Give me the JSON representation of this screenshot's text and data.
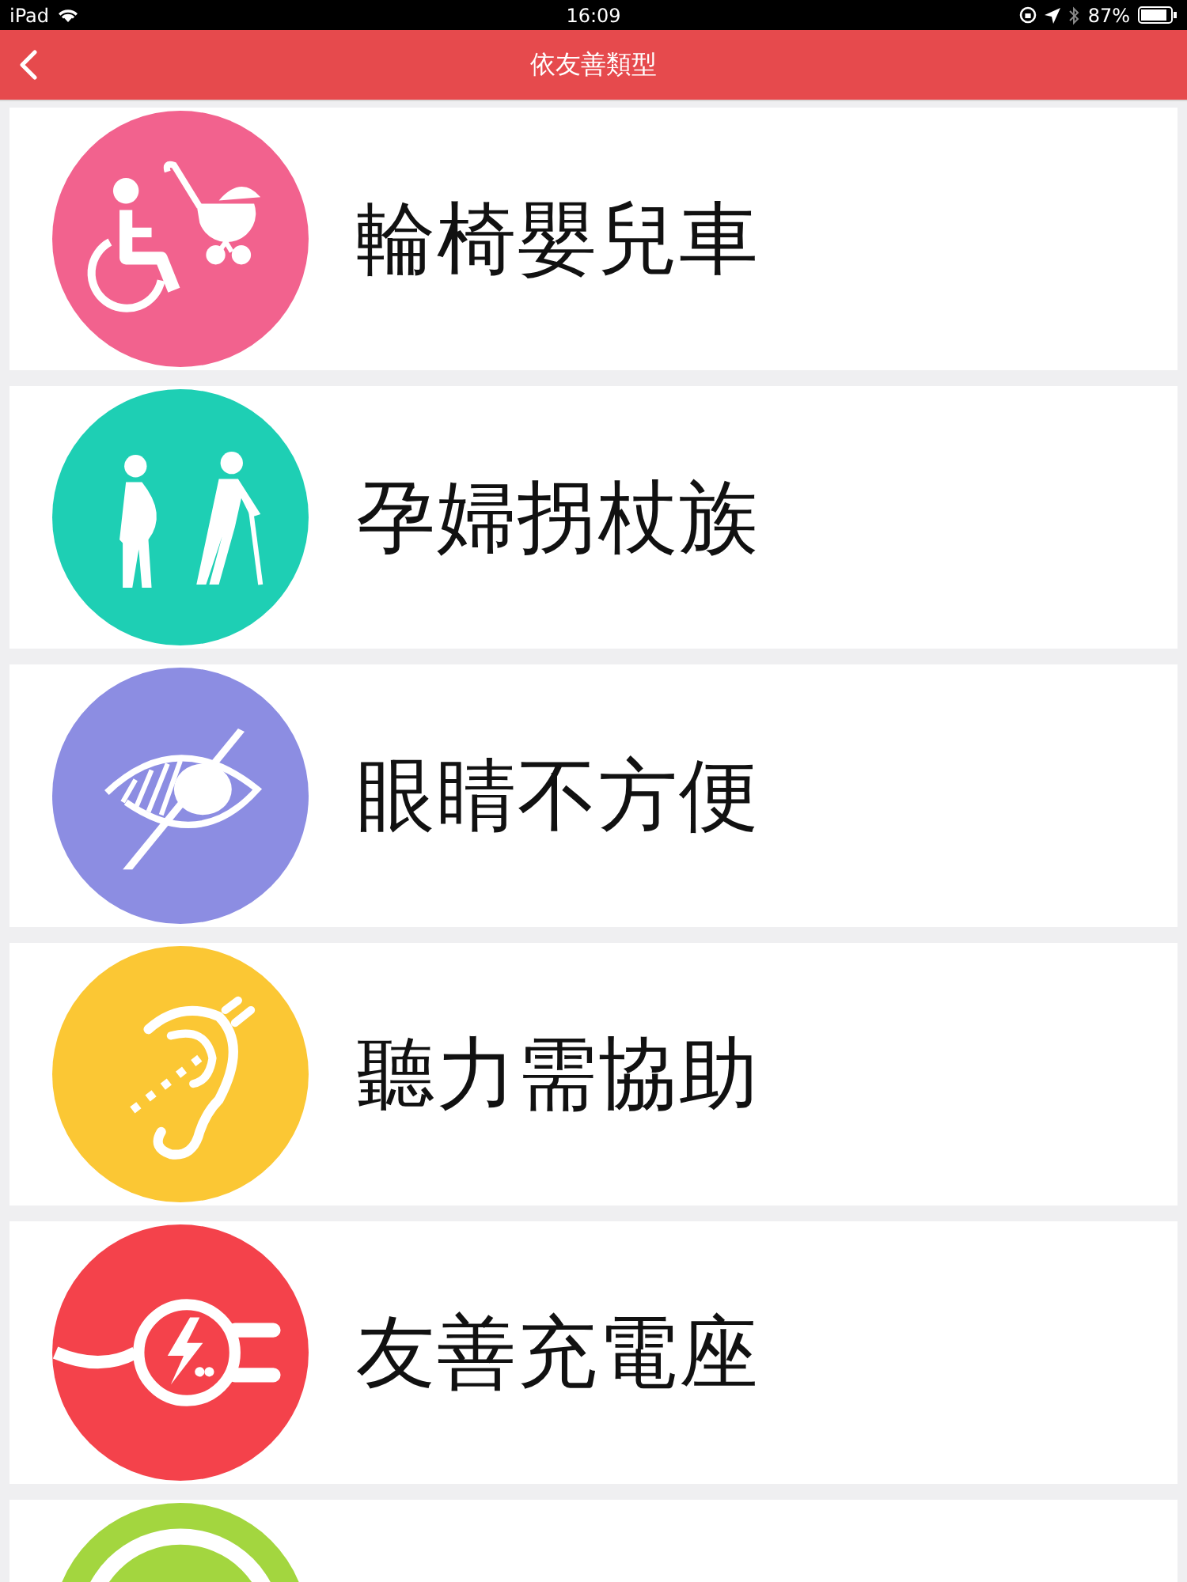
{
  "status_bar": {
    "device": "iPad",
    "time": "16:09",
    "battery": "87%"
  },
  "header": {
    "title": "依友善類型"
  },
  "categories": [
    {
      "kind": "wheelchair",
      "label": "輪椅嬰兒車",
      "color": "#f2628e"
    },
    {
      "kind": "pregnant",
      "label": "孕婦拐杖族",
      "color": "#1ecfb4"
    },
    {
      "kind": "eye",
      "label": "眼睛不方便",
      "color": "#8c8de2"
    },
    {
      "kind": "ear",
      "label": "聽力需協助",
      "color": "#fbc734"
    },
    {
      "kind": "plug",
      "label": "友善充電座",
      "color": "#f4424b"
    },
    {
      "kind": "ring",
      "color": "#a3d63f"
    }
  ]
}
